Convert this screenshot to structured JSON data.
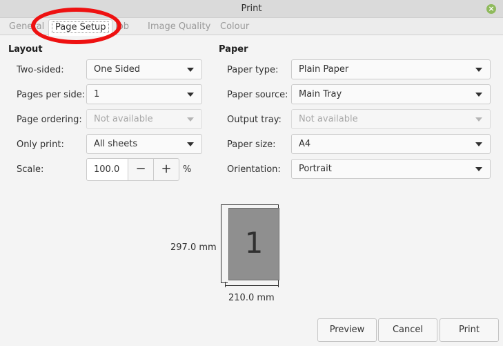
{
  "window": {
    "title": "Print",
    "close_glyph": "×"
  },
  "tabs": [
    {
      "label": "General"
    },
    {
      "label": "Page Setup"
    },
    {
      "label": "Job"
    },
    {
      "label": "Image Quality"
    },
    {
      "label": "Colour"
    }
  ],
  "layout": {
    "heading": "Layout",
    "two_sided": {
      "label": "Two-sided:",
      "value": "One Sided"
    },
    "pages_per_side": {
      "label": "Pages per side:",
      "value": "1"
    },
    "page_ordering": {
      "label": "Page ordering:",
      "value": "Not available"
    },
    "only_print": {
      "label": "Only print:",
      "value": "All sheets"
    },
    "scale": {
      "label": "Scale:",
      "value": "100.0",
      "minus": "−",
      "plus": "+",
      "unit": "%"
    }
  },
  "paper": {
    "heading": "Paper",
    "paper_type": {
      "label": "Paper type:",
      "value": "Plain Paper"
    },
    "paper_source": {
      "label": "Paper source:",
      "value": "Main Tray"
    },
    "output_tray": {
      "label": "Output tray:",
      "value": "Not available"
    },
    "paper_size": {
      "label": "Paper size:",
      "value": "A4"
    },
    "orientation": {
      "label": "Orientation:",
      "value": "Portrait"
    }
  },
  "preview": {
    "page_number": "1",
    "height_label": "297.0 mm",
    "width_label": "210.0 mm"
  },
  "buttons": {
    "preview": "Preview",
    "cancel": "Cancel",
    "print": "Print"
  },
  "colors": {
    "annotation": "#ee1111",
    "close_button": "#8fba5c"
  }
}
